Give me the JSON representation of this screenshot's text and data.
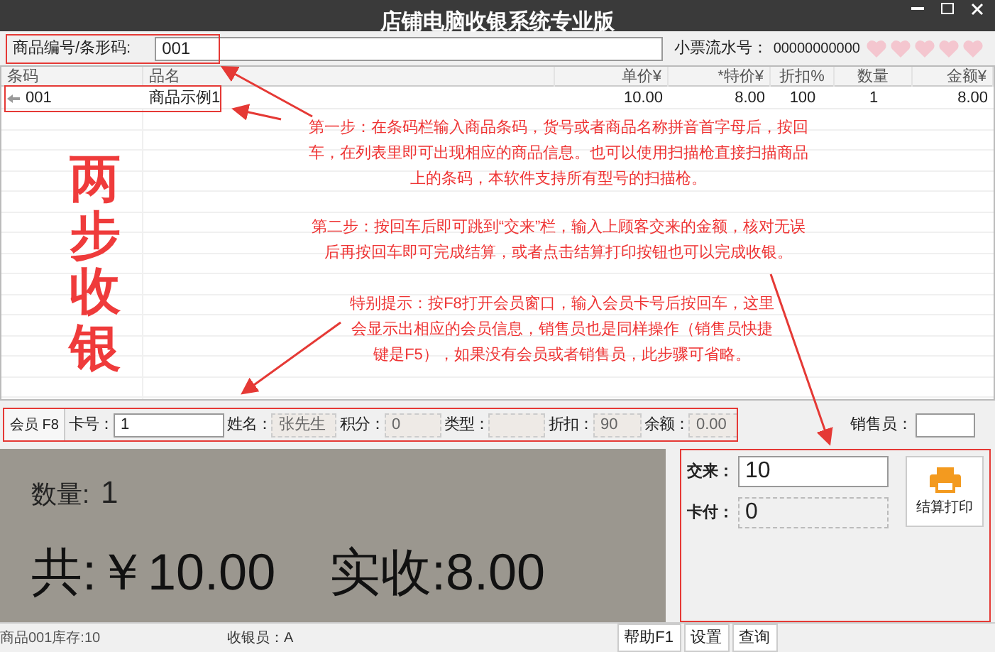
{
  "window": {
    "title": "店铺电脑收银系统专业版"
  },
  "search": {
    "label": "商品编号/条形码:",
    "value": "001"
  },
  "receipt": {
    "label": "小票流水号：",
    "value": "00000000000"
  },
  "table": {
    "columns": [
      {
        "label": "条码"
      },
      {
        "label": "品名"
      },
      {
        "label": "单价¥"
      },
      {
        "label": "*特价¥"
      },
      {
        "label": "折扣%"
      },
      {
        "label": "数量"
      },
      {
        "label": "金额¥"
      }
    ],
    "rows": [
      {
        "selected": false,
        "cells": [
          "001",
          "商品示例1",
          "10.00",
          "8.00",
          "100",
          "1",
          "8.00"
        ]
      }
    ]
  },
  "banner": "两步收银",
  "annotations": [
    {
      "text": "第一步：在条码栏输入商品条码，货号或者商品名称拼音首字母后，按回车，在列表里即可出现相应的商品信息。也可以使用扫描枪直接扫描商品上的条码，本软件支持所有型号的扫描枪。"
    },
    {
      "text": "第二步：按回车后即可跳到“交来”栏，输入上顾客交来的金额，核对无误后再按回车即可完成结算，或者点击结算打印按钮也可以完成收银。"
    },
    {
      "text": "特别提示：按F8打开会员窗口，输入会员卡号后按回车，这里会显示出相应的会员信息，销售员也是同样操作（销售员快捷键是F5），如果没有会员或者销售员，此步骤可省略。"
    }
  ],
  "member": {
    "button": "会员 F8",
    "fields": [
      {
        "label": "卡号：",
        "value": "1",
        "kind": "input"
      },
      {
        "label": "姓名：",
        "value": "张先生",
        "kind": "readonly"
      },
      {
        "label": "积分：",
        "value": "0",
        "kind": "readonly"
      },
      {
        "label": "类型：",
        "kind": "readonly"
      },
      {
        "label": "折扣：",
        "value": "90",
        "kind": "readonly"
      },
      {
        "label": "余额：",
        "value": "0.00",
        "kind": "readonly"
      }
    ]
  },
  "salesperson": {
    "label": "销售员："
  },
  "summary": {
    "quantity_label": "数量:",
    "quantity": "1",
    "total": "共:￥10.00",
    "received": "实收:8.00"
  },
  "payment": {
    "fields": [
      {
        "label": "交来：",
        "value": "10",
        "kind": "input"
      },
      {
        "label": "卡付：",
        "value": "0",
        "kind": "readonly"
      }
    ],
    "button": "结算打印"
  },
  "status_bar": {
    "stock": "商品001库存:10",
    "cashier": "收银员：A",
    "buttons": [
      "帮助F1",
      "设置",
      "查询"
    ]
  }
}
